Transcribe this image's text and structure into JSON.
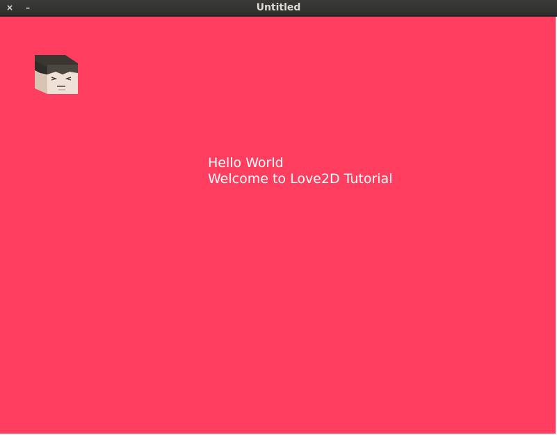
{
  "window": {
    "title": "Untitled",
    "close_glyph": "×",
    "minimize_glyph": "–"
  },
  "canvas": {
    "background_color": "#ff3d5e",
    "text_color": "#ffffff",
    "lines": [
      "Hello World",
      "Welcome to Love2D Tutorial"
    ],
    "sprite_icon": "character-head-sprite"
  }
}
